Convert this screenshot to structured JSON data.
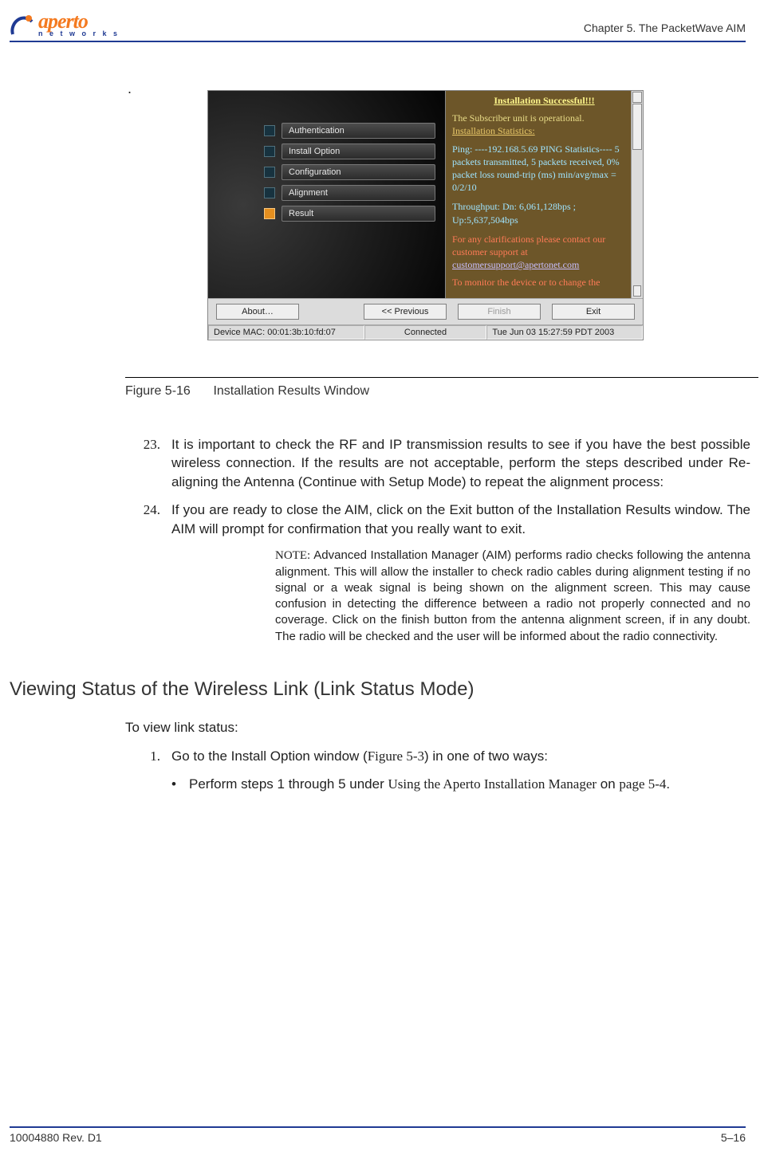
{
  "header": {
    "brand_main": "aperto",
    "brand_sub": "n e t w o r k s",
    "chapter": "Chapter 5.  The PacketWave AIM"
  },
  "screenshot": {
    "dot_leader": ".",
    "steps": [
      {
        "label": "Authentication",
        "active": false
      },
      {
        "label": "Install Option",
        "active": false
      },
      {
        "label": "Configuration",
        "active": false
      },
      {
        "label": "Alignment",
        "active": false
      },
      {
        "label": "Result",
        "active": true
      }
    ],
    "result_title": "Installation Successful!!!",
    "line_op": "The Subscriber unit is operational.",
    "line_stats": "Installation Statistics:",
    "ping": "Ping: ----192.168.5.69 PING Statistics---- 5 packets transmitted, 5 packets received, 0% packet loss round-trip (ms) min/avg/max = 0/2/10",
    "throughput": "Throughput: Dn: 6,061,128bps ; Up:5,637,504bps",
    "contact": "For any clarifications please contact our customer support at",
    "link": "customersupport@apertonet.com",
    "monitor": "To monitor the device or to change the",
    "buttons": {
      "about": "About…",
      "prev": "<< Previous",
      "finish": "Finish",
      "exit": "Exit"
    },
    "status": {
      "mac": "Device MAC: 00:01:3b:10:fd:07",
      "conn": "Connected",
      "time": "Tue Jun 03 15:27:59 PDT 2003"
    }
  },
  "figure": {
    "num": "Figure 5-16",
    "title": "Installation Results Window"
  },
  "list": {
    "n23": "23.",
    "t23": "It is important to check the RF and IP transmission results to see if you have the best possible wireless connection. If the results are not acceptable, perform the steps described under Re-aligning the Antenna (Continue with Setup Mode) to repeat the alignment process:",
    "n24": "24.",
    "t24": "If you are ready to close the AIM, click on the Exit button of the Installation Results window. The AIM will prompt for confirmation that you really want to exit."
  },
  "note": {
    "label": "NOTE:  ",
    "body": "Advanced Installation Manager (AIM) performs radio checks following the antenna alignment. This will allow the installer to check radio cables during alignment testing if no signal or a weak signal is being shown on the alignment screen. This may cause confusion in detecting the difference between a radio not properly connected and no coverage. Click on the finish button from the antenna alignment screen, if in any doubt. The radio will be checked and the user will be informed about the radio connectivity."
  },
  "section_heading": "Viewing Status of the Wireless Link (Link Status Mode)",
  "para_intro": "To view link status:",
  "step1": {
    "num": "1.",
    "pre": "Go to the Install Option window (",
    "figref": "Figure 5-3",
    "post": ") in one of two ways:"
  },
  "bullet1": {
    "pre": "Perform steps 1 through 5 under ",
    "link": "Using the Aperto Installation Manager",
    "mid": " on ",
    "page": "page 5-4",
    "post": "."
  },
  "footer": {
    "rev": "10004880 Rev. D1",
    "page": "5–16"
  }
}
